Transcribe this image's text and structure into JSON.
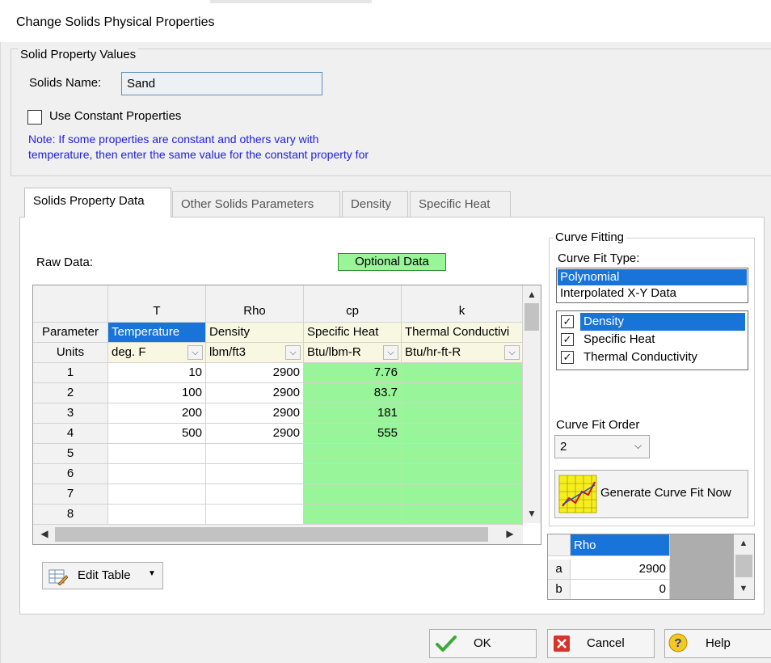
{
  "window": {
    "title": "Change Solids Physical Properties"
  },
  "solid_props": {
    "group_label": "Solid Property Values",
    "name_label": "Solids Name:",
    "name_value": "Sand",
    "constant_label": "Use Constant Properties",
    "constant_checked": false,
    "note_line1": "Note: If some properties are constant and others vary with",
    "note_line2": "temperature, then enter the same value for the constant property for"
  },
  "tabs": [
    {
      "label": "Solids Property Data",
      "active": true
    },
    {
      "label": "Other Solids Parameters",
      "active": false
    },
    {
      "label": "Density",
      "active": false
    },
    {
      "label": "Specific Heat",
      "active": false
    }
  ],
  "raw": {
    "label": "Raw Data:",
    "optional_label": "Optional Data"
  },
  "grid": {
    "columns": [
      {
        "symbol": "T",
        "parameter": "Temperature",
        "unit": "deg. F"
      },
      {
        "symbol": "Rho",
        "parameter": "Density",
        "unit": "lbm/ft3"
      },
      {
        "symbol": "cp",
        "parameter": "Specific Heat",
        "unit": "Btu/lbm-R"
      },
      {
        "symbol": "k",
        "parameter": "Thermal Conductivi",
        "unit": "Btu/hr-ft-R"
      }
    ],
    "row_header_parameter": "Parameter",
    "row_header_units": "Units",
    "rows": [
      {
        "n": "1",
        "T": "10",
        "Rho": "2900",
        "cp": "7.76",
        "k": ""
      },
      {
        "n": "2",
        "T": "100",
        "Rho": "2900",
        "cp": "83.7",
        "k": ""
      },
      {
        "n": "3",
        "T": "200",
        "Rho": "2900",
        "cp": "181",
        "k": ""
      },
      {
        "n": "4",
        "T": "500",
        "Rho": "2900",
        "cp": "555",
        "k": ""
      },
      {
        "n": "5",
        "T": "",
        "Rho": "",
        "cp": "",
        "k": ""
      },
      {
        "n": "6",
        "T": "",
        "Rho": "",
        "cp": "",
        "k": ""
      },
      {
        "n": "7",
        "T": "",
        "Rho": "",
        "cp": "",
        "k": ""
      },
      {
        "n": "8",
        "T": "",
        "Rho": "",
        "cp": "",
        "k": ""
      }
    ]
  },
  "edit_table": {
    "label": "Edit Table"
  },
  "curve_fitting": {
    "group_label": "Curve Fitting",
    "type_label": "Curve Fit Type:",
    "types": [
      "Polynomial",
      "Interpolated X-Y Data"
    ],
    "selected_type": "Polynomial",
    "properties": [
      {
        "label": "Density",
        "checked": true
      },
      {
        "label": "Specific Heat",
        "checked": true
      },
      {
        "label": "Thermal Conductivity",
        "checked": true
      }
    ],
    "order_label": "Curve Fit Order",
    "order_value": "2",
    "generate_label": "Generate Curve Fit Now"
  },
  "coefficients": {
    "column_header": "Rho",
    "rows": [
      {
        "name": "a",
        "value": "2900"
      },
      {
        "name": "b",
        "value": "0"
      }
    ]
  },
  "buttons": {
    "ok": "OK",
    "cancel": "Cancel",
    "help": "Help"
  },
  "colors": {
    "accent": "#1874d8",
    "optional_green": "#99f599",
    "note_blue": "#1e1ee0",
    "panel_bg": "#f0f0f0"
  },
  "icons": {
    "scroll_up": "▲",
    "scroll_down": "▼",
    "scroll_left": "◀",
    "scroll_right": "▶",
    "dropdown": "⌵",
    "check": "✓",
    "caret_down": "▼",
    "help": "?"
  }
}
